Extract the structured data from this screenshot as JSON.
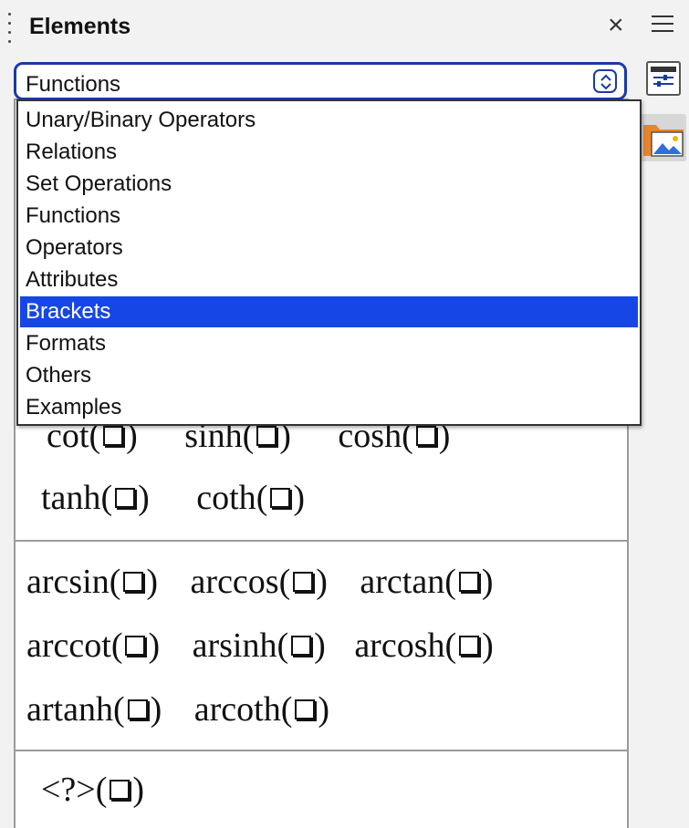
{
  "panel": {
    "title": "Elements"
  },
  "category": {
    "selected": "Functions",
    "options": [
      {
        "label": "Unary/Binary Operators",
        "highlighted": false
      },
      {
        "label": "Relations",
        "highlighted": false
      },
      {
        "label": "Set Operations",
        "highlighted": false
      },
      {
        "label": "Functions",
        "highlighted": false
      },
      {
        "label": "Operators",
        "highlighted": false
      },
      {
        "label": "Attributes",
        "highlighted": false
      },
      {
        "label": "Brackets",
        "highlighted": true
      },
      {
        "label": "Formats",
        "highlighted": false
      },
      {
        "label": "Others",
        "highlighted": false
      },
      {
        "label": "Examples",
        "highlighted": false
      }
    ]
  },
  "elements": {
    "hyperbolic_group": [
      "cot",
      "sinh",
      "cosh",
      "tanh",
      "coth"
    ],
    "arc_group": [
      "arcsin",
      "arccos",
      "arctan",
      "arccot",
      "arsinh",
      "arcosh",
      "artanh",
      "arcoth"
    ],
    "custom_group": [
      "<?>"
    ]
  },
  "icons": {
    "header_grip": "drag-handle-icon",
    "close": "close-icon",
    "menu": "hamburger-menu-icon",
    "combo_arrow": "up-down-chevron-icon",
    "sidebar_properties": "properties-icon",
    "sidebar_gallery": "gallery-icon"
  },
  "colors": {
    "accent": "#1b3aa8",
    "selection": "#1647e6",
    "gallery_folder": "#e8852a"
  }
}
